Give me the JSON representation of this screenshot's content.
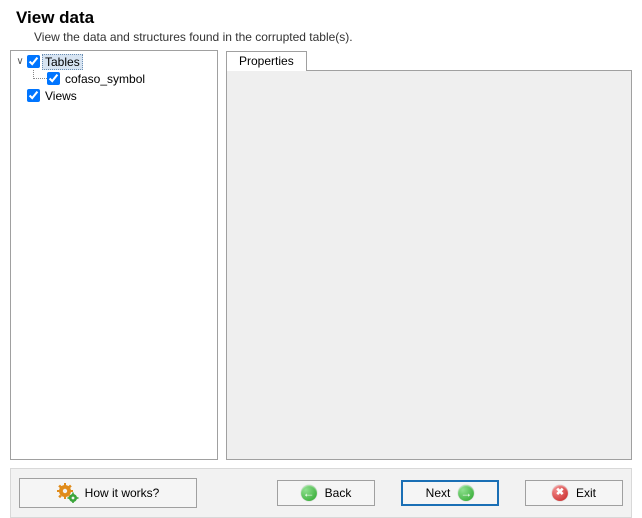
{
  "header": {
    "title": "View data",
    "subtitle": "View the data and structures found in the corrupted table(s)."
  },
  "tree": {
    "tables": {
      "label": "Tables",
      "checked": true,
      "expanded": true
    },
    "cofaso": {
      "label": "cofaso_symbol",
      "checked": true
    },
    "views": {
      "label": "Views",
      "checked": true
    }
  },
  "tabs": {
    "properties": "Properties"
  },
  "buttons": {
    "how": "How it works?",
    "back": "Back",
    "next": "Next",
    "exit": "Exit"
  }
}
